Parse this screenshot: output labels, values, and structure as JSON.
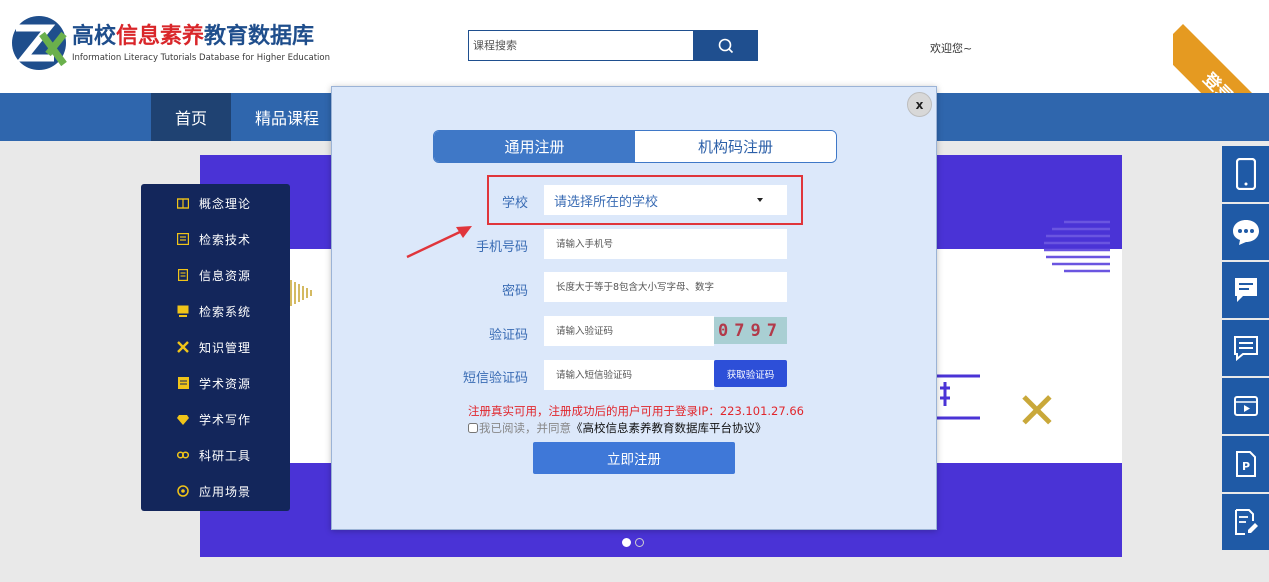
{
  "header": {
    "logo_title_part1": "高校",
    "logo_title_part2": "信息素养",
    "logo_title_part3": "教育数据库",
    "logo_subtitle": "Information Literacy Tutorials Database for Higher Education",
    "search_placeholder": "课程搜索",
    "welcome": "欢迎您~",
    "login_label": "登录"
  },
  "nav": {
    "items": [
      {
        "label": "首页",
        "active": true
      },
      {
        "label": "精品课程",
        "active": false
      }
    ]
  },
  "side_menu": {
    "items": [
      {
        "label": "概念理论",
        "icon": "book-icon"
      },
      {
        "label": "检索技术",
        "icon": "search-doc-icon"
      },
      {
        "label": "信息资源",
        "icon": "document-icon"
      },
      {
        "label": "检索系统",
        "icon": "monitor-icon"
      },
      {
        "label": "知识管理",
        "icon": "tools-icon"
      },
      {
        "label": "学术资源",
        "icon": "folder-icon"
      },
      {
        "label": "学术写作",
        "icon": "diamond-icon"
      },
      {
        "label": "科研工具",
        "icon": "link-icon"
      },
      {
        "label": "应用场景",
        "icon": "compass-icon"
      }
    ]
  },
  "right_bar": {
    "items": [
      "mobile-icon",
      "chat-bubble-icon",
      "message-icon",
      "comment-icon",
      "video-icon",
      "ppt-icon",
      "edit-icon"
    ]
  },
  "modal": {
    "close_label": "x",
    "tabs": [
      {
        "label": "通用注册",
        "active": true
      },
      {
        "label": "机构码注册",
        "active": false
      }
    ],
    "school_label": "学校",
    "school_placeholder": "请选择所在的学校",
    "phone_label": "手机号码",
    "phone_placeholder": "请输入手机号",
    "password_label": "密码",
    "password_placeholder": "长度大于等于8包含大小写字母、数字",
    "captcha_label": "验证码",
    "captcha_placeholder": "请输入验证码",
    "captcha_value": "0797",
    "sms_label": "短信验证码",
    "sms_placeholder": "请输入短信验证码",
    "sms_button": "获取验证码",
    "notice": "注册真实可用，注册成功后的用户可用于登录IP：223.101.27.66",
    "agree_prefix": "我已阅读，并同意",
    "agree_link": "《高校信息素养教育数据库平台协议》",
    "submit_label": "立即注册"
  },
  "banner": {
    "slide_count": 2,
    "active_slide": 1
  },
  "colors": {
    "nav_bg": "#2f66ad",
    "nav_active": "#1f4272",
    "side_bg": "#13265b",
    "banner_purple": "#4a33d6",
    "modal_bg": "#dce8fa",
    "accent_blue": "#3f78c7",
    "highlight_red": "#e0353b",
    "ribbon_orange": "#e59a21"
  }
}
